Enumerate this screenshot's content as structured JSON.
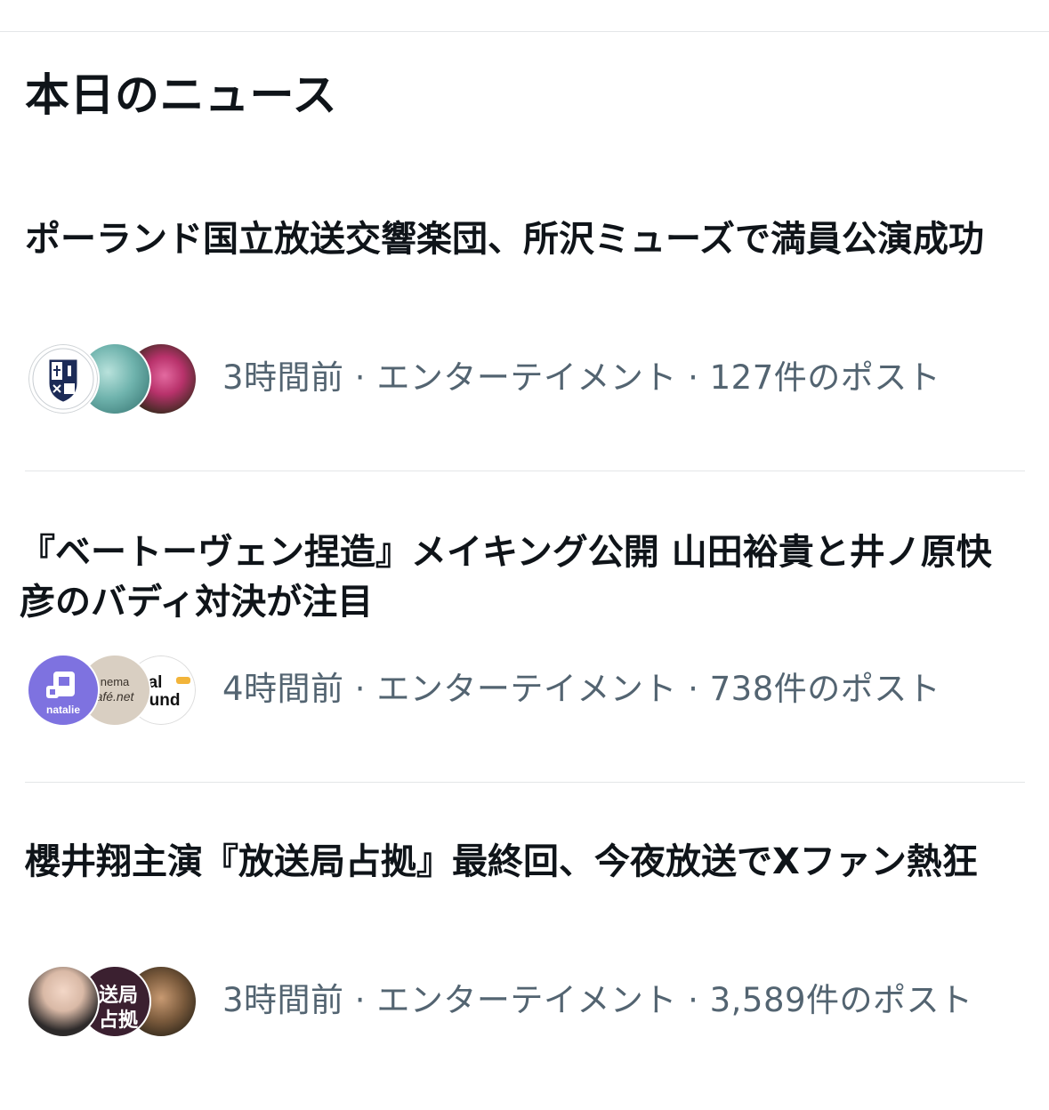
{
  "header": {
    "title": "本日のニュース"
  },
  "news": [
    {
      "headline": "ポーランド国立放送交響楽団、所沢ミューズで満員公演成功",
      "meta": "3時間前 · エンターテイメント · 127件のポスト",
      "avatars": [
        "muse-logo-icon",
        "water-photo",
        "rose-photo"
      ]
    },
    {
      "headline": "『ベートーヴェン捏造』メイキング公開 山田裕貴と井ノ原快彦のバディ対決が注目",
      "meta": "4時間前 · エンターテイメント · 738件のポスト",
      "avatars": [
        "natalie-logo-icon",
        "cinemacafe-logo-icon",
        "realsound-logo-icon"
      ],
      "avatar_text": {
        "natalie": "natalie",
        "cinema_1": "nema",
        "cinema_2": "afé.net",
        "realsound_1": "eal",
        "realsound_2": "ound"
      }
    },
    {
      "headline": "櫻井翔主演『放送局占拠』最終回、今夜放送でXファン熱狂",
      "meta": "3時間前 · エンターテイメント · 3,589件のポスト",
      "avatars": [
        "person-photo",
        "housoukyoku-logo-icon",
        "person-photo"
      ],
      "avatar_text": {
        "housou_1": "送局",
        "housou_2": "占拠"
      }
    }
  ],
  "colors": {
    "text_primary": "#0f1419",
    "text_secondary": "#536471",
    "divider": "#e4e6e8",
    "natalie_purple": "#7e72e0"
  }
}
